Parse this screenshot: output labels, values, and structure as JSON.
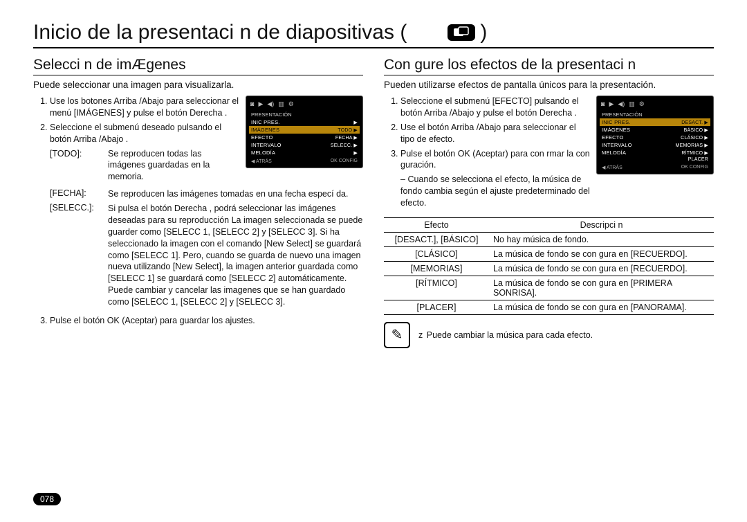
{
  "page_number": "078",
  "title": "Inicio de la presentaci n de diapositivas (",
  "title_close": ")",
  "left": {
    "heading": "Selecci n de imÆgenes",
    "intro": "Puede seleccionar una imagen para visualizarla.",
    "step1": "Use los botones Arriba /Abajo para seleccionar el menú [IMÁGENES] y pulse el botón Derecha .",
    "step2": "Seleccione el submenú deseado pulsando el botón Arriba /Abajo .",
    "defs": {
      "todo_label": "[TODO]:",
      "todo_text": "Se reproducen todas las imágenes guardadas en la memoria.",
      "fecha_label": "[FECHA]:",
      "fecha_text": "Se reproducen las imágenes tomadas en una fecha especí da.",
      "selecc_label": "[SELECC.]:",
      "selecc_text": "Si pulsa el botón Derecha , podrá seleccionar las imágenes deseadas para su reproducción La imagen seleccionada se puede guarder como [SELECC 1, [SELECC 2] y [SELECC 3]. Si ha seleccionado la imagen con el comando [New Select] se guardará como [SELECC 1]. Pero, cuando se guarda de nuevo una imagen nueva utilizando [New Select], la imagen anterior guardada como [SELECC 1] se guardará como [SELECC 2] automáticamente. Puede cambiar y cancelar las imagenes que se han guardado como [SELECC 1, [SELECC 2] y [SELECC 3]."
    },
    "step3": "Pulse el botón OK (Aceptar) para guardar los ajustes.",
    "lcd": {
      "section": "PRESENTACIÓN",
      "rows": [
        {
          "l": "INIC PRES.",
          "r": "",
          "hl": false,
          "play": true
        },
        {
          "l": "IMÁGENES",
          "r": "TODO",
          "hl": true,
          "play": true
        },
        {
          "l": "EFECTO",
          "r": "FECHA",
          "hl": false,
          "play": true
        },
        {
          "l": "INTERVALO",
          "r": "SELECC.",
          "hl": false,
          "play": true
        },
        {
          "l": "MELODÍA",
          "r": "",
          "hl": false,
          "play": true
        }
      ],
      "back": "◀ ATRÁS",
      "ok": "OK   CONFIG"
    }
  },
  "right": {
    "heading": "Con   gure los efectos de la presentaci n",
    "intro": "Pueden utilizarse efectos de pantalla únicos para la presentación.",
    "step1": "Seleccione el submenú [EFECTO] pulsando el botón Arriba /Abajo y pulse el botón Derecha .",
    "step2": "Use el botón Arriba /Abajo para seleccionar el tipo de efecto.",
    "step3": "Pulse el botón OK (Aceptar) para con rmar la con guración.",
    "step3_sub": "Cuando se selecciona el efecto, la música de fondo cambia según el ajuste predeterminado del efecto.",
    "lcd": {
      "section": "PRESENTACIÓN",
      "rows": [
        {
          "l": "INIC PRES.",
          "r": "DESACT.",
          "hl": true,
          "play": true
        },
        {
          "l": "IMÁGENES",
          "r": "BÁSICO",
          "hl": false,
          "play": true
        },
        {
          "l": "EFECTO",
          "r": "CLÁSICO",
          "hl": false,
          "play": true
        },
        {
          "l": "INTERVALO",
          "r": "MEMORIAS",
          "hl": false,
          "play": true
        },
        {
          "l": "MELODÍA",
          "r": "RÍTMICO",
          "hl": false,
          "play": true
        },
        {
          "l": "",
          "r": "PLACER",
          "hl": false,
          "play": false
        }
      ],
      "back": "◀ ATRÁS",
      "ok": "OK   CONFIG"
    },
    "table": {
      "head_effect": "Efecto",
      "head_desc": "Descripci n",
      "rows": [
        {
          "e": "[DESACT.], [BÁSICO]",
          "d": "No hay música de fondo."
        },
        {
          "e": "[CLÁSICO]",
          "d": "La música de fondo se con gura en [RECUERDO]."
        },
        {
          "e": "[MEMORIAS]",
          "d": "La música de fondo se con gura en [RECUERDO]."
        },
        {
          "e": "[RÍTMICO]",
          "d": "La música de fondo se con gura en [PRIMERA SONRISA]."
        },
        {
          "e": "[PLACER]",
          "d": "La música de fondo se con gura en [PANORAMA]."
        }
      ]
    },
    "note": "Puede cambiar la música para cada efecto."
  }
}
